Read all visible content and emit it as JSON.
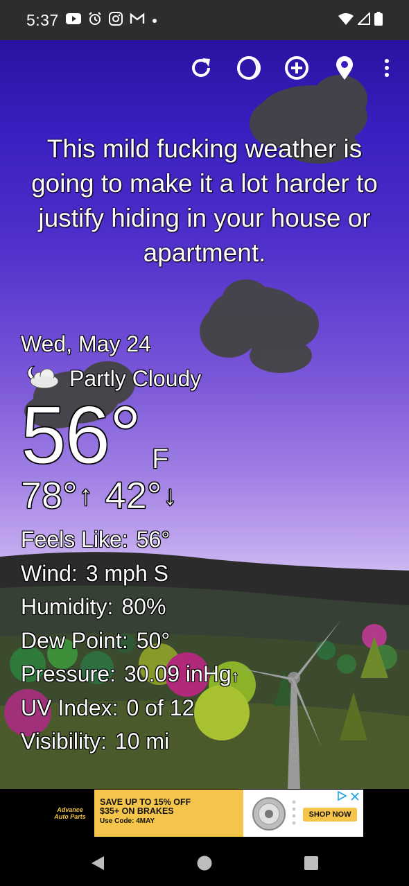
{
  "status_bar": {
    "time": "5:37",
    "icons_left": [
      "youtube-icon",
      "alarm-icon",
      "instagram-icon",
      "gmail-icon",
      "dot-icon"
    ],
    "icons_right": [
      "wifi-icon",
      "signal-icon",
      "battery-icon"
    ]
  },
  "toolbar": {
    "buttons": [
      "refresh-icon",
      "moon-phase-icon",
      "add-location-icon",
      "location-pin-icon",
      "overflow-menu-icon"
    ]
  },
  "quote": "This mild fucking weather is going to make it a lot harder to justify hiding in your house or apartment.",
  "weather": {
    "date": "Wed, May 24",
    "condition": "Partly Cloudy",
    "condition_icon": "partly-cloudy-night-icon",
    "temperature": "56°",
    "unit": "F",
    "high": "78°",
    "high_arrow": "↑",
    "low": "42°",
    "low_arrow": "↓",
    "details": [
      {
        "label": "Feels Like:",
        "value": "56°",
        "trend": ""
      },
      {
        "label": "Wind:",
        "value": "3 mph S",
        "trend": ""
      },
      {
        "label": "Humidity:",
        "value": "80%",
        "trend": ""
      },
      {
        "label": "Dew Point:",
        "value": "50°",
        "trend": ""
      },
      {
        "label": "Pressure:",
        "value": "30.09 inHg",
        "trend": "↑"
      },
      {
        "label": "UV Index:",
        "value": "0 of 12",
        "trend": ""
      },
      {
        "label": "Visibility:",
        "value": "10 mi",
        "trend": ""
      }
    ]
  },
  "ad": {
    "brand": "Advance Auto Parts",
    "line1": "SAVE UP TO 15% OFF",
    "line2": "$35+ ON BRAKES",
    "line3": "Use Code: 4MAY",
    "cta": "SHOP NOW"
  },
  "nav_bar": {
    "buttons": [
      "back-icon",
      "home-icon",
      "recents-icon"
    ]
  },
  "colors": {
    "sky_top": "#2a12a0",
    "sky_bottom": "#d9c9f5",
    "ad_yellow": "#f4c54a",
    "status_bar": "#2d2d2d"
  }
}
